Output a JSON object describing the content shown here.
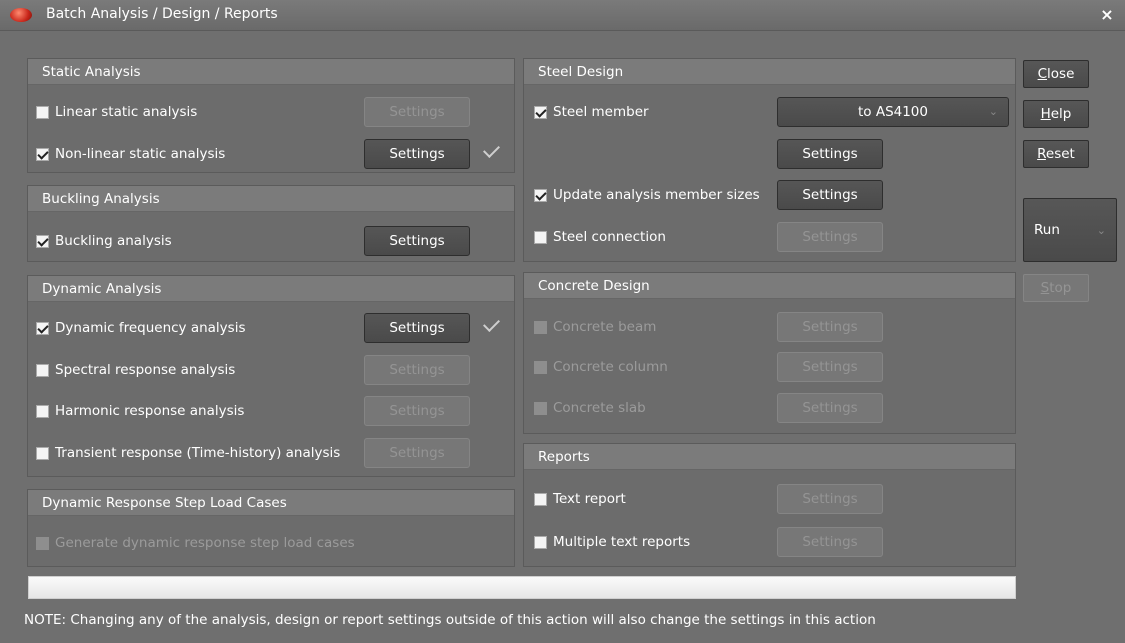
{
  "window": {
    "title": "Batch Analysis / Design / Reports",
    "close_glyph": "×"
  },
  "static_analysis": {
    "header": "Static Analysis",
    "items": [
      {
        "label": "Linear static analysis",
        "checked": false,
        "button": "Settings",
        "button_enabled": false
      },
      {
        "label": "Non-linear static analysis",
        "checked": true,
        "button": "Settings",
        "button_enabled": true,
        "done": true
      }
    ]
  },
  "buckling_analysis": {
    "header": "Buckling Analysis",
    "items": [
      {
        "label": "Buckling analysis",
        "checked": true,
        "button": "Settings",
        "button_enabled": true
      }
    ]
  },
  "dynamic_analysis": {
    "header": "Dynamic Analysis",
    "items": [
      {
        "label": "Dynamic frequency analysis",
        "checked": true,
        "button": "Settings",
        "button_enabled": true,
        "done": true
      },
      {
        "label": "Spectral response analysis",
        "checked": false,
        "button": "Settings",
        "button_enabled": false
      },
      {
        "label": "Harmonic response analysis",
        "checked": false,
        "button": "Settings",
        "button_enabled": false
      },
      {
        "label": "Transient response (Time-history) analysis",
        "checked": false,
        "button": "Settings",
        "button_enabled": false
      }
    ]
  },
  "dynamic_step": {
    "header": "Dynamic Response Step Load Cases",
    "items": [
      {
        "label": "Generate dynamic response step load cases",
        "checked": false,
        "enabled": false
      }
    ]
  },
  "steel_design": {
    "header": "Steel Design",
    "steel_member": {
      "label": "Steel member",
      "checked": true,
      "standard": "to AS4100",
      "button": "Settings"
    },
    "update_sizes": {
      "label": "Update analysis member sizes",
      "checked": true,
      "button": "Settings"
    },
    "steel_connection": {
      "label": "Steel connection",
      "checked": false,
      "button": "Settings",
      "button_enabled": false
    }
  },
  "concrete_design": {
    "header": "Concrete Design",
    "items": [
      {
        "label": "Concrete beam",
        "button": "Settings"
      },
      {
        "label": "Concrete column",
        "button": "Settings"
      },
      {
        "label": "Concrete slab",
        "button": "Settings"
      }
    ]
  },
  "reports": {
    "header": "Reports",
    "items": [
      {
        "label": "Text report",
        "checked": false,
        "button": "Settings"
      },
      {
        "label": "Multiple text reports",
        "checked": false,
        "button": "Settings"
      }
    ]
  },
  "side": {
    "close": {
      "first": "C",
      "rest": "lose"
    },
    "help": {
      "first": "H",
      "rest": "elp"
    },
    "reset": {
      "first": "R",
      "rest": "eset"
    },
    "run": "Run",
    "stop": {
      "first": "S",
      "rest": "top"
    }
  },
  "progress": {
    "value": 0
  },
  "note": "NOTE: Changing any of the analysis, design or report settings outside of this action will also change the settings in this action"
}
